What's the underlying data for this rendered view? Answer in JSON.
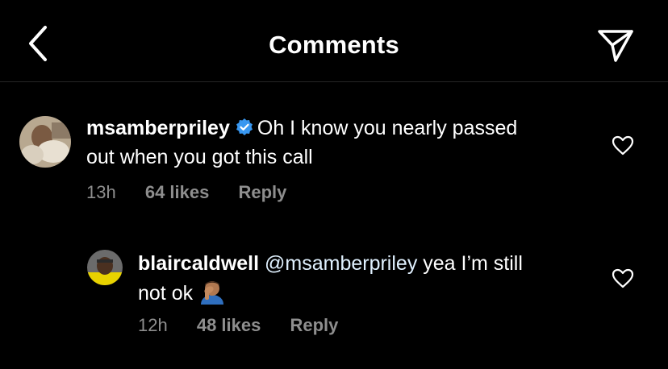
{
  "header": {
    "title": "Comments",
    "back_icon": "chevron-left-icon",
    "send_icon": "paper-plane-icon"
  },
  "comments": [
    {
      "username": "msamberpriley",
      "verified": true,
      "text_line1": "Oh I know you nearly passed",
      "text_line2": "out when you got this call",
      "time": "13h",
      "likes": "64 likes",
      "reply": "Reply"
    },
    {
      "username": "blaircaldwell",
      "mention": "@msamberpriley",
      "text_line1": "yea I’m still",
      "text_line2": "not ok",
      "emoji": "man-facepalming-emoji",
      "time": "12h",
      "likes": "48 likes",
      "reply": "Reply"
    }
  ],
  "colors": {
    "background": "#000000",
    "text": "#ffffff",
    "meta": "#8e8e8e",
    "verified": "#3897f0",
    "mention": "#e0f1ff"
  }
}
